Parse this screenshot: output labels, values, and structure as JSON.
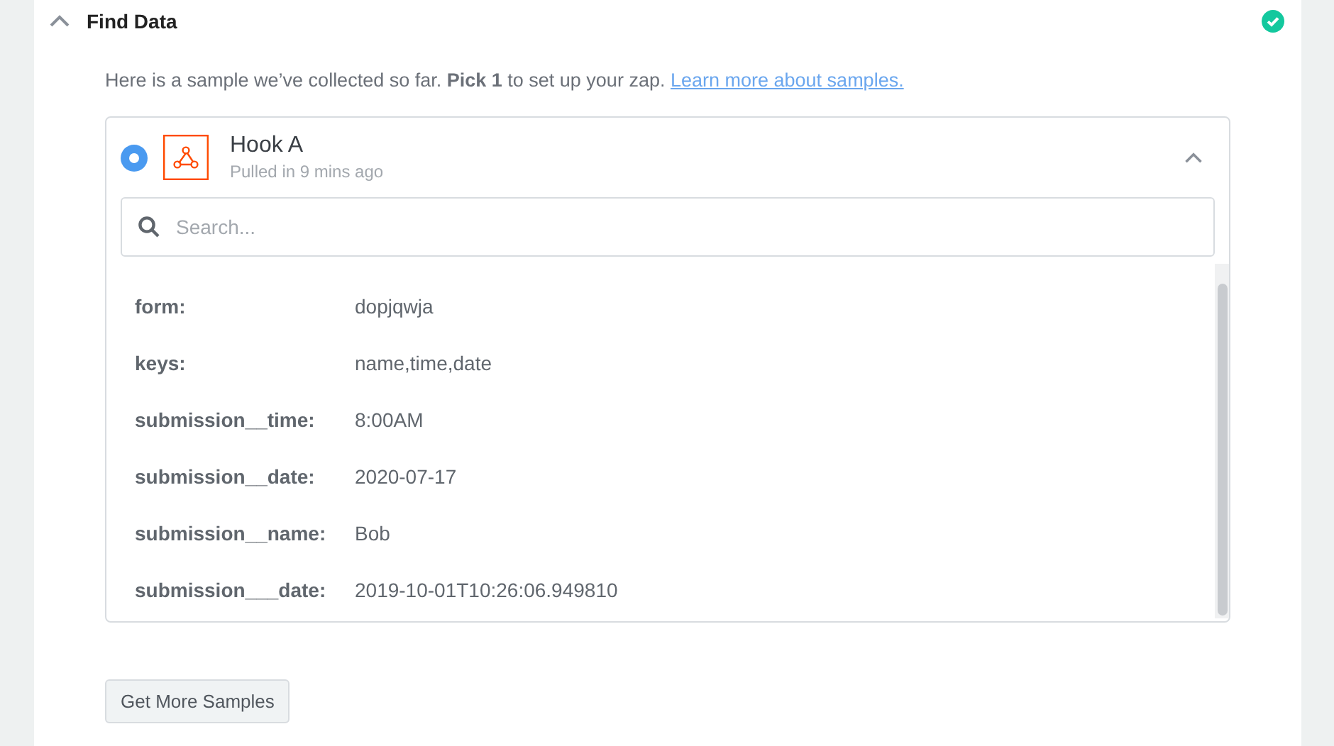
{
  "section": {
    "title": "Find Data",
    "expanded": true,
    "complete": true
  },
  "intro": {
    "text": "Here is a sample we’ve collected so far. **Pick 1** to set up your zap.",
    "link": "Learn more about samples."
  },
  "sample": {
    "title": "Hook A",
    "subtitle": "Pulled in 9 mins ago",
    "selected": true,
    "expanded": true,
    "search_placeholder": "Search...",
    "fields": [
      {
        "key": "form:",
        "value": "dopjqwja"
      },
      {
        "key": "keys:",
        "value": "name,time,date"
      },
      {
        "key": "submission__time:",
        "value": "8:00AM"
      },
      {
        "key": "submission__date:",
        "value": "2020-07-17"
      },
      {
        "key": "submission__name:",
        "value": "Bob"
      },
      {
        "key": "submission___date:",
        "value": "2019-10-01T10:26:06.949810"
      }
    ]
  },
  "button": "Get More Samples"
}
